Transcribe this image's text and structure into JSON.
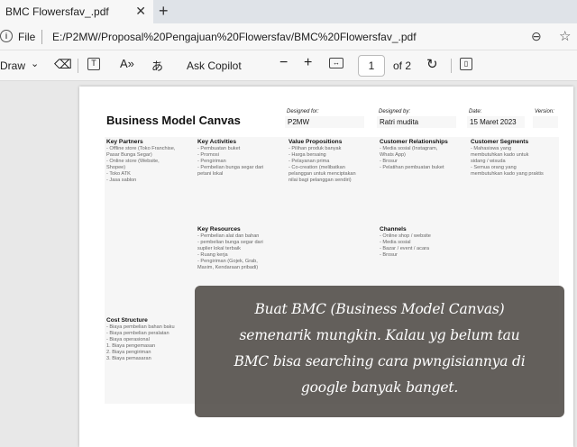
{
  "browser": {
    "tab_title": "BMC Flowersfav_.pdf",
    "address_label": "File",
    "url": "E:/P2MW/Proposal%20Pengajuan%20Flowersfav/BMC%20Flowersfav_.pdf"
  },
  "toolbar": {
    "draw_label": "Draw",
    "copilot_label": "Ask Copilot",
    "page_current": "1",
    "page_of": "of 2"
  },
  "bmc": {
    "title": "Business Model Canvas",
    "designed_for_label": "Designed for:",
    "designed_for": "P2MW",
    "designed_by_label": "Designed by:",
    "designed_by": "Ratri mudita",
    "date_label": "Date:",
    "date": "15 Maret 2023",
    "version_label": "Version:",
    "key_partners": {
      "title": "Key Partners",
      "lines": [
        "- Offline store (Toko Franchise,",
        "Pasar Bunga Segar)",
        "- Online store (Website,",
        "Shopee)",
        "- Toko ATK",
        "- Jasa sablon"
      ]
    },
    "key_activities": {
      "title": "Key Activities",
      "lines": [
        "- Pembuatan buket",
        "- Promosi",
        "- Pengiriman",
        "- Pembelian bunga segar dari",
        "petani lokal"
      ]
    },
    "value_propositions": {
      "title": "Value Propositions",
      "lines": [
        "- Pilihan produk banyak",
        "- Harga bersaing",
        "- Pelayanan prima",
        "- Co-creation (melibatkan",
        "pelanggan untuk menciptakan",
        "nilai bagi pelanggan sendiri)"
      ]
    },
    "customer_relationships": {
      "title": "Customer Relationships",
      "lines": [
        "- Media sosial (Instagram,",
        "Whats App)",
        "- Brosur",
        "- Pelatihan pembuatan buket"
      ]
    },
    "customer_segments": {
      "title": "Customer Segments",
      "lines": [
        "- Mahasiswa yang",
        "membutuhkan kado untuk",
        "sidang / wisuda",
        "- Semua orang yang",
        "membutuhkan kado yang praktis"
      ]
    },
    "key_resources": {
      "title": "Key Resources",
      "lines": [
        "- Pembelian alat dan bahan",
        "- pembelian bunga segar dari",
        "suplier lokal terbaik",
        "- Ruang kerja",
        "- Pengiriman (Gojek, Grab,",
        "Maxim, Kendaraan pribadi)"
      ]
    },
    "channels": {
      "title": "Channels",
      "lines": [
        "- Online shop / website",
        "- Media sosial",
        "- Bazar / event / acara",
        "- Brosur"
      ]
    },
    "cost_structure": {
      "title": "Cost Structure",
      "lines": [
        "- Biaya pembelian bahan baku",
        "- Biaya pembelian peralatan",
        "- Biaya operasional",
        "  1. Biaya pengemasan",
        "  2. Biaya pengiriman",
        "  3. Biaya pemasaran"
      ]
    }
  },
  "overlay": {
    "lines": [
      "Buat BMC (Business Model Canvas)",
      "semenarik mungkin. Kalau yg belum tau",
      "BMC bisa searching cara pwngisiannya di",
      "google banyak banget."
    ]
  }
}
